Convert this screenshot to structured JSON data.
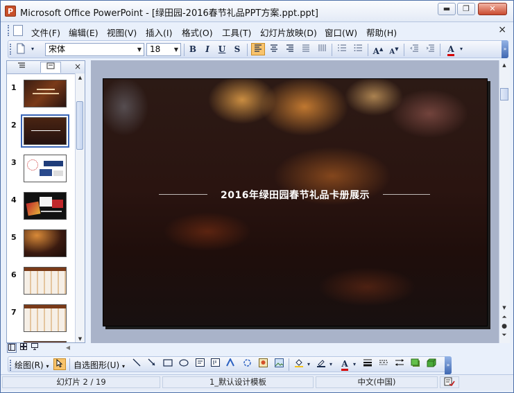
{
  "window": {
    "app_icon_letter": "P",
    "title": "Microsoft Office PowerPoint - [绿田园-2016春节礼品PPT方案.ppt.ppt]",
    "minimize_symbol": "▬",
    "restore_symbol": "❐",
    "close_symbol": "✕"
  },
  "menubar": {
    "items": [
      {
        "label": "文件(F)"
      },
      {
        "label": "编辑(E)"
      },
      {
        "label": "视图(V)"
      },
      {
        "label": "插入(I)"
      },
      {
        "label": "格式(O)"
      },
      {
        "label": "工具(T)"
      },
      {
        "label": "幻灯片放映(D)"
      },
      {
        "label": "窗口(W)"
      },
      {
        "label": "帮助(H)"
      }
    ],
    "close_symbol": "×"
  },
  "toolbar": {
    "font_name": "宋体",
    "font_size": "18",
    "bold": "B",
    "italic": "I",
    "underline": "U",
    "shadow": "S",
    "font_color_letter": "A",
    "grow_font": "A",
    "shrink_font": "A"
  },
  "slides_pane": {
    "close_symbol": "×",
    "slides": [
      {
        "number": "1"
      },
      {
        "number": "2"
      },
      {
        "number": "3"
      },
      {
        "number": "4"
      },
      {
        "number": "5"
      },
      {
        "number": "6"
      },
      {
        "number": "7"
      }
    ],
    "selected_slide": "2"
  },
  "current_slide": {
    "title": "2016年绿田园春节礼品卡册展示"
  },
  "drawing_toolbar": {
    "draw_label": "绘图(R)",
    "autoshapes_label": "自选图形(U)",
    "font_color_letter": "A"
  },
  "statusbar": {
    "slide_position": "幻灯片 2 / 19",
    "design_template": "1_默认设计模板",
    "language": "中文(中国)"
  },
  "colors": {
    "accent": "#3a66b8",
    "active_button": "#f8c36c",
    "font_color_underline": "#d40000"
  }
}
